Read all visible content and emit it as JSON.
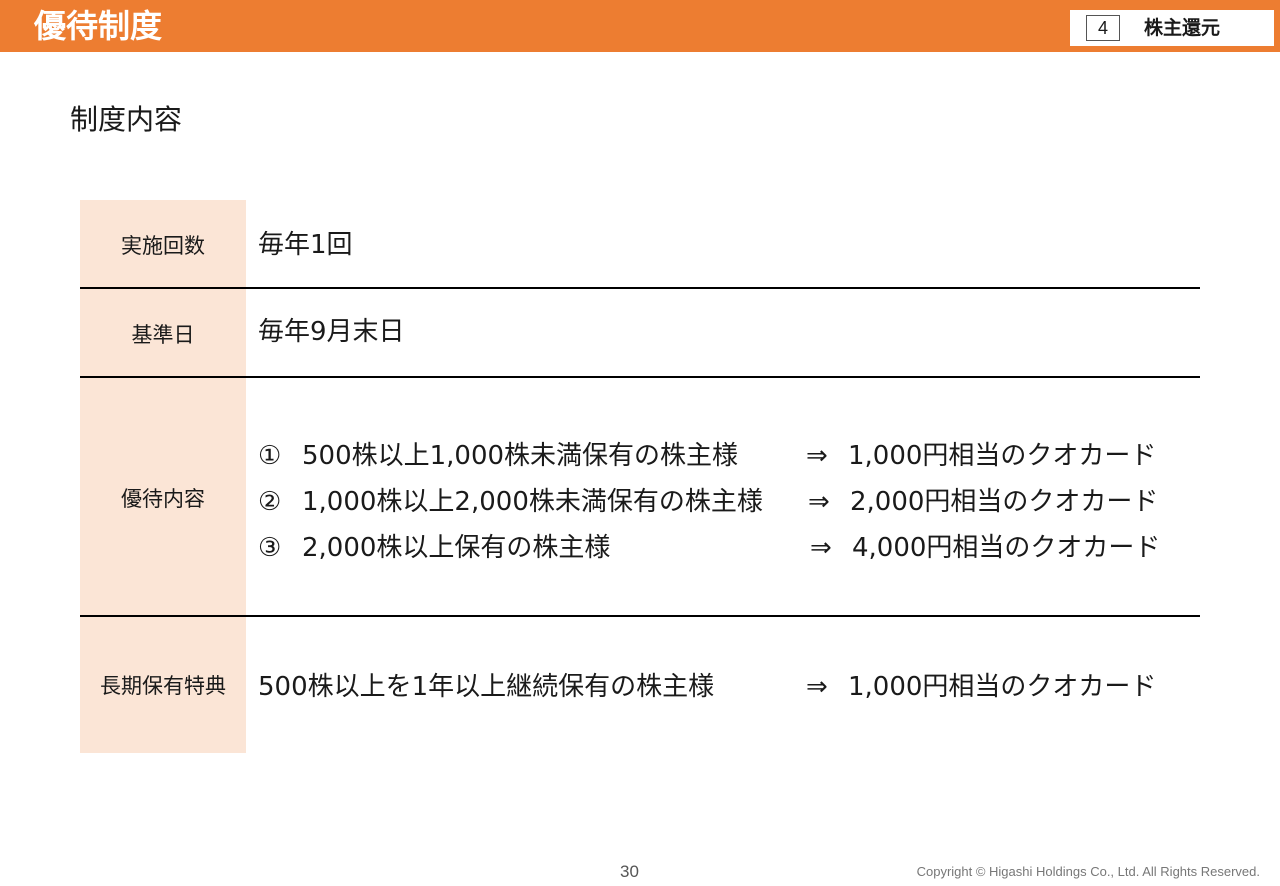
{
  "header": {
    "title": "優待制度",
    "section_number": "4",
    "section_label": "株主還元"
  },
  "subtitle": "制度内容",
  "table": {
    "frequency": {
      "label": "実施回数",
      "value": "毎年1回"
    },
    "record_date": {
      "label": "基準日",
      "value": "毎年9月末日"
    },
    "benefits": {
      "label": "優待内容",
      "tiers": [
        {
          "mark": "①",
          "condition": "500株以上1,000株未満保有の株主様",
          "arrow": "⇒",
          "reward": "1,000円相当のクオカード"
        },
        {
          "mark": "②",
          "condition": "1,000株以上2,000株未満保有の株主様",
          "arrow": "⇒",
          "reward": "2,000円相当のクオカード"
        },
        {
          "mark": "③",
          "condition": "2,000株以上保有の株主様",
          "arrow": "⇒",
          "reward": "4,000円相当のクオカード"
        }
      ]
    },
    "long_term": {
      "label": "長期保有特典",
      "condition": "500株以上を1年以上継続保有の株主様",
      "arrow": "⇒",
      "reward": "1,000円相当のクオカード"
    }
  },
  "footer": {
    "page_number": "30",
    "copyright": "Copyright © Higashi Holdings Co., Ltd. All Rights Reserved."
  }
}
